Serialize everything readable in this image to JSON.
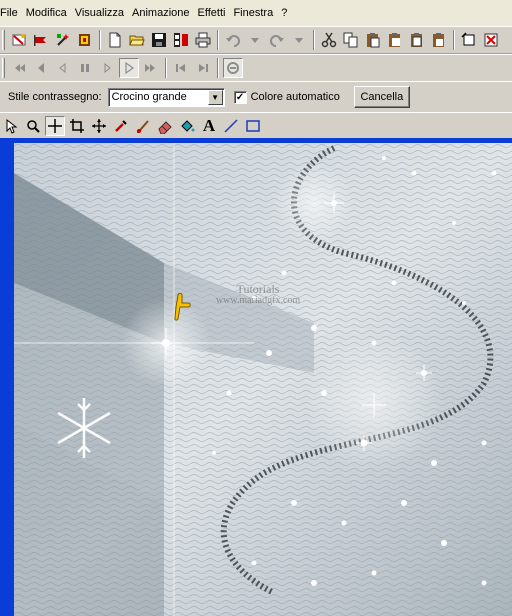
{
  "menu": {
    "items": [
      {
        "label": "File"
      },
      {
        "label": "Modifica"
      },
      {
        "label": "Visualizza"
      },
      {
        "label": "Animazione"
      },
      {
        "label": "Effetti"
      },
      {
        "label": "Finestra"
      },
      {
        "label": "?"
      }
    ]
  },
  "toolbar_main": {
    "icons": [
      "wizard-icon",
      "banner-icon",
      "magic-icon",
      "import-icon",
      "new-icon",
      "open-icon",
      "save-icon",
      "frames-icon",
      "print-icon",
      "undo-icon",
      "undo-dropdown-icon",
      "redo-icon",
      "redo-dropdown-icon",
      "cut-icon",
      "copy-icon",
      "paste-icon",
      "paste-before-icon",
      "paste-after-icon",
      "paste-into-icon",
      "select-all-icon",
      "clear-icon"
    ]
  },
  "toolbar_playback": {
    "icons": [
      "first-frame-icon",
      "prev-frame-icon",
      "step-back-icon",
      "pause-icon",
      "step-forward-icon",
      "play-icon",
      "next-frame-icon",
      "fast-back-icon",
      "fast-forward-icon",
      "preview-icon"
    ]
  },
  "options_bar": {
    "stile_label": "Stile contrassegno:",
    "stile_value": "Crocino grande",
    "auto_color_label": "Colore automatico",
    "auto_color_checked": true,
    "cancel_label": "Cancella"
  },
  "tools": {
    "icons": [
      "arrow-tool-icon",
      "zoom-tool-icon",
      "crosshair-tool-icon",
      "crop-tool-icon",
      "move-tool-icon",
      "dropper-tool-icon",
      "brush-tool-icon",
      "eraser-tool-icon",
      "fill-tool-icon",
      "text-tool-icon",
      "line-tool-icon",
      "rectangle-tool-icon"
    ],
    "text_glyph": "A"
  },
  "canvas": {
    "watermark_line1": "Tutorials",
    "watermark_line2": "www.mariadgfx.com",
    "colors": {
      "workspace": "#0a3cd8",
      "image_base": "#b7c1c8",
      "image_dark": "#6f7d87"
    }
  }
}
